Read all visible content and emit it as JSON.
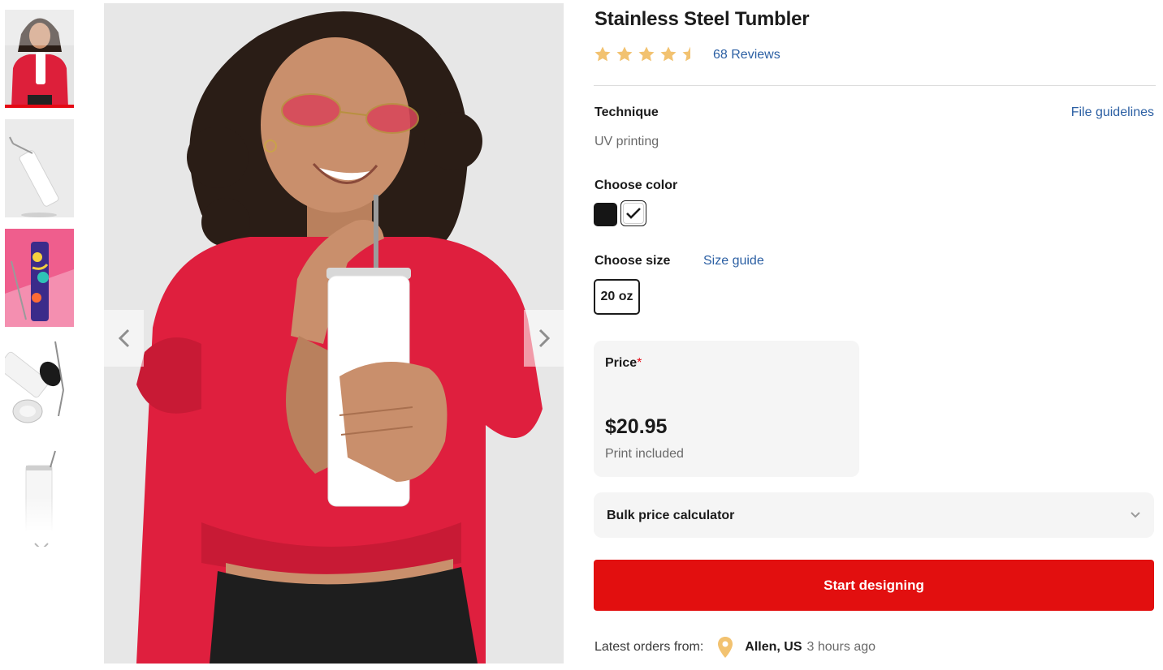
{
  "product": {
    "title": "Stainless Steel Tumbler",
    "rating": 4.5,
    "reviews_label": "68 Reviews"
  },
  "colors": {
    "accent": "#e20f0f",
    "link": "#2b5fa3",
    "star": "#f2c270"
  },
  "technique": {
    "label": "Technique",
    "value": "UV printing",
    "guidelines_link": "File guidelines"
  },
  "color_picker": {
    "label": "Choose color",
    "options": [
      "black",
      "white"
    ],
    "selected": "white"
  },
  "size_picker": {
    "label": "Choose size",
    "guide_link": "Size guide",
    "options": [
      "20 oz"
    ],
    "selected": "20 oz"
  },
  "price": {
    "label": "Price",
    "required_mark": "*",
    "value": "$20.95",
    "note": "Print included"
  },
  "bulk": {
    "label": "Bulk price calculator"
  },
  "cta": {
    "label": "Start designing"
  },
  "orders": {
    "label": "Latest orders from:",
    "location": "Allen, US",
    "time": "3 hours ago"
  },
  "gallery": {
    "active_index": 0,
    "thumbnails": [
      "model-with-tumbler",
      "tumbler-with-straw-white",
      "tumbler-colorful-print",
      "tumbler-lid-and-straw",
      "tumbler-with-straw-tall"
    ]
  }
}
